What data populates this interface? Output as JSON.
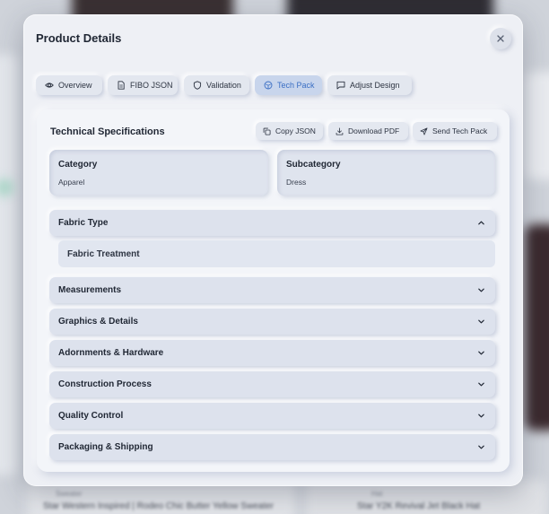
{
  "background": {
    "left_snippet_1": "Sweater",
    "left_snippet_2": "Star Western Inspired | Rodeo Chic Butter Yellow Sweater",
    "right_snippet_1": "Hat",
    "right_snippet_2": "Star Y2K Revival Jet Black Hat"
  },
  "modal": {
    "title": "Product Details",
    "close_icon": "x-icon"
  },
  "tabs": [
    {
      "label": "Overview",
      "icon": "eye-icon",
      "active": false
    },
    {
      "label": "FIBO JSON",
      "icon": "document-icon",
      "active": false
    },
    {
      "label": "Validation",
      "icon": "shield-icon",
      "active": false
    },
    {
      "label": "Tech Pack",
      "icon": "package-icon",
      "active": true
    },
    {
      "label": "Adjust Design",
      "icon": "message-square-icon",
      "active": false
    }
  ],
  "panel": {
    "title": "Technical Specifications",
    "actions": {
      "copy_json": "Copy JSON",
      "download_pdf": "Download PDF",
      "send_tech_pack": "Send Tech Pack"
    },
    "category": {
      "label": "Category",
      "value": "Apparel"
    },
    "subcategory": {
      "label": "Subcategory",
      "value": "Dress"
    },
    "sections": [
      {
        "label": "Fabric Type",
        "expanded": true
      },
      {
        "label": "Measurements",
        "expanded": false
      },
      {
        "label": "Graphics & Details",
        "expanded": false
      },
      {
        "label": "Adornments & Hardware",
        "expanded": false
      },
      {
        "label": "Construction Process",
        "expanded": false
      },
      {
        "label": "Quality Control",
        "expanded": false
      },
      {
        "label": "Packaging & Shipping",
        "expanded": false
      }
    ],
    "fabric_sub_item": "Fabric Treatment"
  },
  "colors": {
    "accent": "#3b6fc4",
    "active_tab_bg": "#c8d5ec",
    "text_primary": "#1f2633"
  }
}
